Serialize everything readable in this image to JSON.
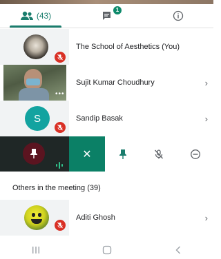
{
  "tabs": {
    "people_count": "(43)",
    "chat_badge": "1"
  },
  "participants": [
    {
      "name": "The School of Aesthetics (You)"
    },
    {
      "name": "Sujit Kumar Choudhury"
    },
    {
      "name": "Sandip Basak",
      "initial": "S"
    }
  ],
  "pinned_row": {
    "close_symbol": "✕"
  },
  "others": {
    "label": "Others in the meeting (39)",
    "items": [
      {
        "name": "Aditi Ghosh"
      }
    ]
  },
  "colors": {
    "accent": "#1a7d6d",
    "mic_off": "#d93025",
    "avatar_teal": "#13a3a0"
  }
}
